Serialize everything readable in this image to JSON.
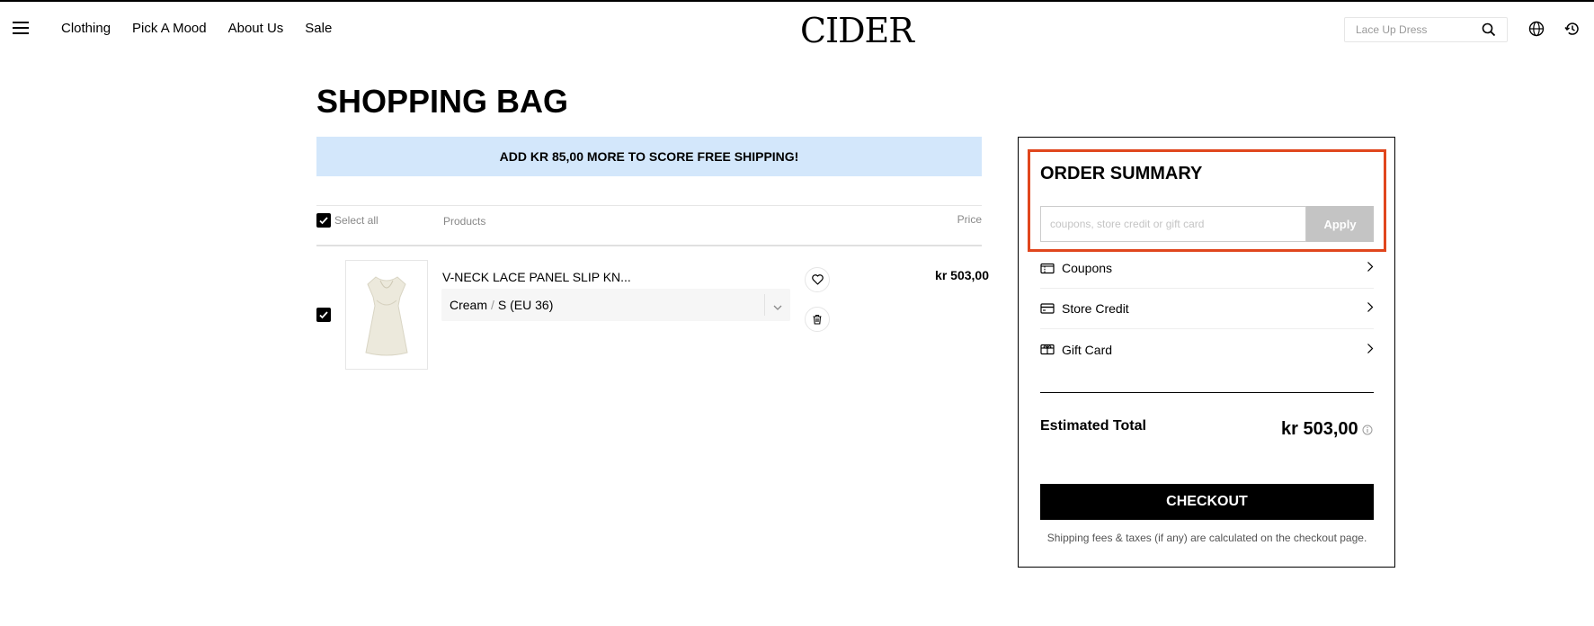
{
  "header": {
    "nav": [
      "Clothing",
      "Pick A Mood",
      "About Us",
      "Sale"
    ],
    "logo": "CIDER",
    "search_placeholder": "Lace Up Dress"
  },
  "page": {
    "title": "SHOPPING BAG",
    "banner": "ADD KR 85,00 MORE TO SCORE FREE SHIPPING!"
  },
  "table": {
    "select_all": "Select all",
    "col_products": "Products",
    "col_price": "Price"
  },
  "item": {
    "title": "V-NECK LACE PANEL SLIP KN...",
    "color": "Cream",
    "size": "S (EU 36)",
    "price": "kr 503,00",
    "checked": true
  },
  "summary": {
    "title": "ORDER SUMMARY",
    "coupon_placeholder": "coupons, store credit or gift card",
    "apply_label": "Apply",
    "options": [
      "Coupons",
      "Store Credit",
      "Gift Card"
    ],
    "estimated_label": "Estimated Total",
    "estimated_value": "kr 503,00",
    "checkout_label": "CHECKOUT",
    "shipping_note": "Shipping fees & taxes (if any) are calculated on the checkout page."
  },
  "colors": {
    "banner_bg": "#d3e7fb",
    "highlight": "#e0461d",
    "apply_bg": "#c4c4c4"
  }
}
